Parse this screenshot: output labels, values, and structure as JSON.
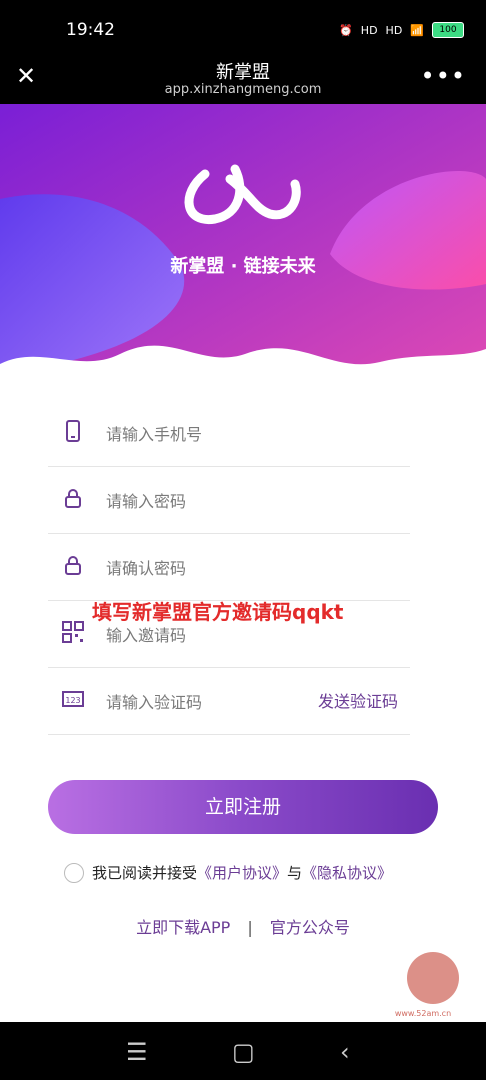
{
  "status_bar": {
    "time": "19:42",
    "battery": "100",
    "signal1": "HD",
    "signal2": "HD"
  },
  "browser": {
    "title": "新掌盟",
    "url": "app.xinzhangmeng.com"
  },
  "hero": {
    "slogan": "新掌盟 · 链接未来"
  },
  "form": {
    "phone_placeholder": "请输入手机号",
    "password_placeholder": "请输入密码",
    "confirm_placeholder": "请确认密码",
    "invite_placeholder": "输入邀请码",
    "code_placeholder": "请输入验证码",
    "send_code": "发送验证码"
  },
  "overlay_text": "填写新掌盟官方邀请码qqkt",
  "register_button": "立即注册",
  "agreement": {
    "prefix": "我已阅读并接受",
    "user_agreement": "《用户协议》",
    "and": "与",
    "privacy": "《隐私协议》"
  },
  "links": {
    "download": "立即下载APP",
    "separator": "|",
    "official": "官方公众号"
  },
  "icons": {
    "close": "close-icon",
    "more": "more-icon",
    "phone": "phone-icon",
    "lock": "lock-icon",
    "qr": "qr-icon",
    "code": "code-icon"
  },
  "colors": {
    "accent": "#6b3d95",
    "overlay": "#e32b2b",
    "hero_start": "#7a1fd6",
    "hero_end": "#e04ab3"
  },
  "watermark_text": "www.52am.cn"
}
